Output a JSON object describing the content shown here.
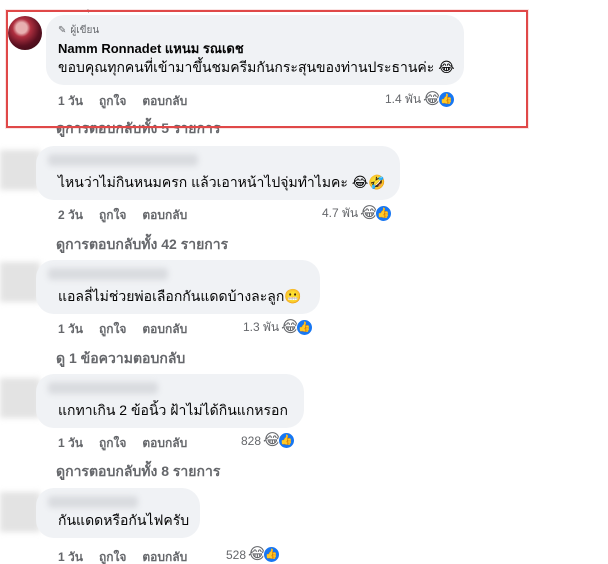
{
  "top_fragment": "ุ",
  "comments": [
    {
      "badge_label": "ผู้เขียน",
      "author": "Namm Ronnadet แหนม รณเดช",
      "text": "ขอบคุณทุกคนที่เข้ามาขึ้นชมครีมกันกระสุนของท่านประธานค่ะ 😂",
      "time": "1 วัน",
      "like_label": "ถูกใจ",
      "reply_label": "ตอบกลับ",
      "reaction_count": "1.4 พัน",
      "reaction_emoji": "😂",
      "view_replies": "ดูการตอบกลับทั้ง 5 รายการ"
    },
    {
      "text": "ไหนว่าไม่กินหนมครก แล้วเอาหน้าไปจุ่มทำไมคะ 😂🤣",
      "time": "2 วัน",
      "like_label": "ถูกใจ",
      "reply_label": "ตอบกลับ",
      "reaction_count": "4.7 พัน",
      "reaction_emoji": "😂",
      "view_replies": "ดูการตอบกลับทั้ง 42 รายการ"
    },
    {
      "text": "แอลลี่ไม่ช่วยพ่อเลือกกันแดดบ้างละลูก😬",
      "time": "1 วัน",
      "like_label": "ถูกใจ",
      "reply_label": "ตอบกลับ",
      "reaction_count": "1.3 พัน",
      "reaction_emoji": "😂",
      "view_replies": "ดู 1 ข้อความตอบกลับ"
    },
    {
      "text": "แกทาเกิน 2 ข้อนิ้ว ฝ้าไม่ได้กินแกหรอก",
      "time": "1 วัน",
      "like_label": "ถูกใจ",
      "reply_label": "ตอบกลับ",
      "reaction_count": "828",
      "reaction_emoji": "😂",
      "view_replies": "ดูการตอบกลับทั้ง 8 รายการ"
    },
    {
      "text": "กันแดดหรือกันไฟครับ",
      "time": "1 วัน",
      "like_label": "ถูกใจ",
      "reply_label": "ตอบกลับ",
      "reaction_count": "528",
      "reaction_emoji": "😂"
    }
  ],
  "like_icon_glyph": "👍",
  "colors": {
    "bubble": "#f0f2f5",
    "highlight": "#e04848",
    "like": "#1877f2",
    "meta": "#65676b"
  }
}
